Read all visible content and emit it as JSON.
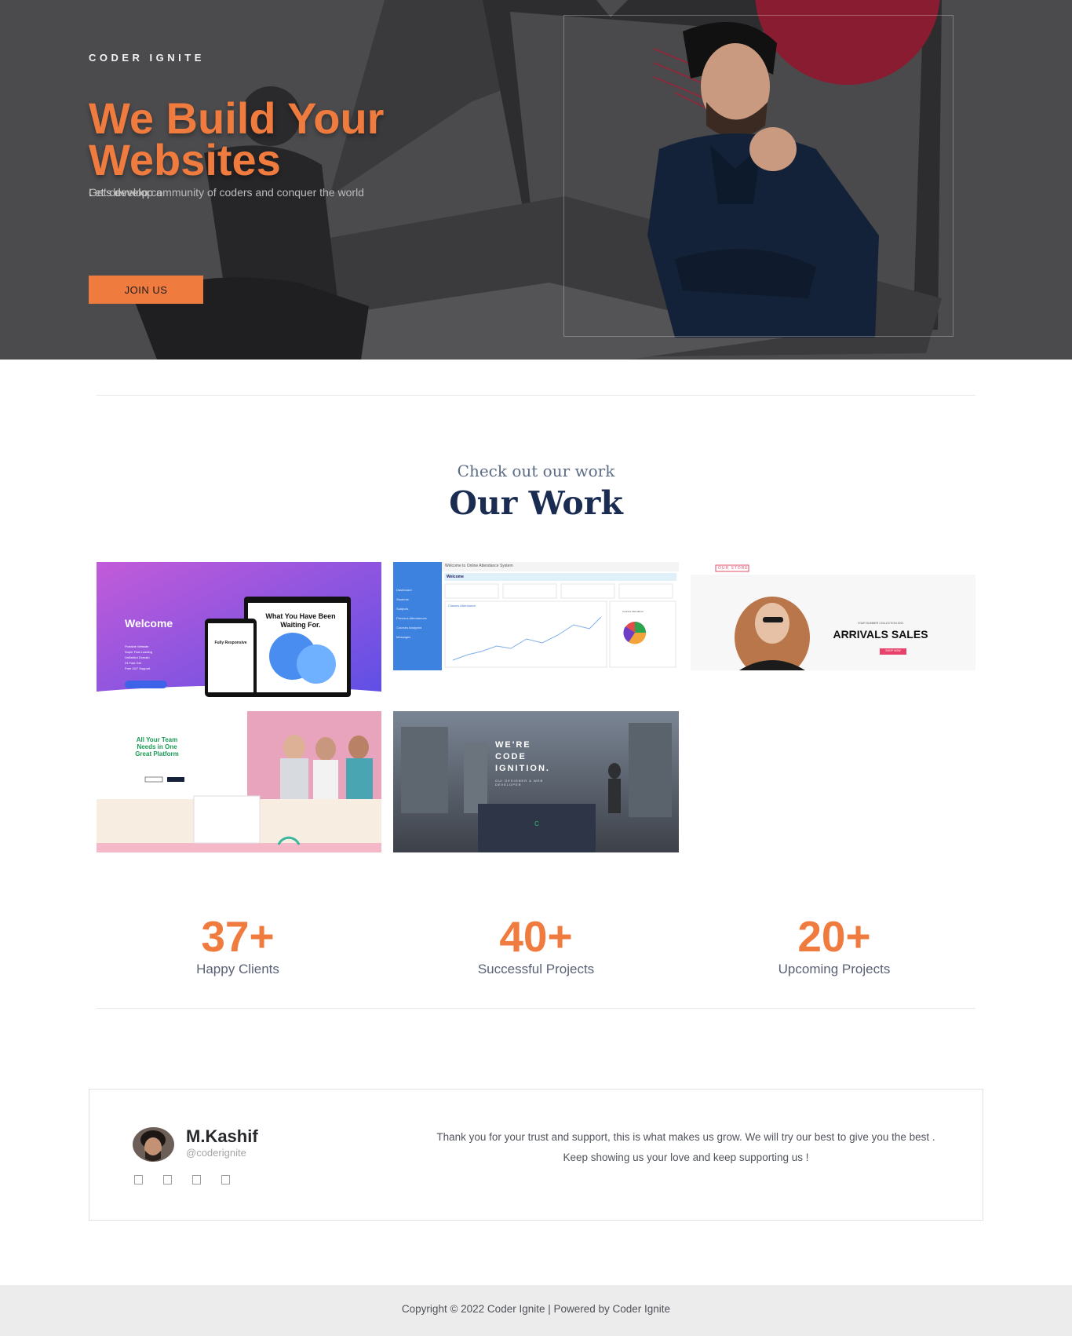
{
  "hero": {
    "brand": "CODER IGNITE",
    "headline": "We Build Your Websites",
    "typed_text": "Let's develop a",
    "tagline": "Get develop community of coders and conquer the world",
    "cta": "JOIN US"
  },
  "work": {
    "subtitle": "Check out our work",
    "title": "Our Work",
    "projects": [
      {
        "welcome": "Welcome",
        "headline": "What You Have Been Waiting For.",
        "device_title": "Fully Responsive",
        "features": [
          "Portable Website",
          "Super Fast Loading",
          "Unlimited Domain",
          "24 Fast Get",
          "Free 24/7 Support"
        ]
      },
      {
        "header": "Welcome to Online Attendance System",
        "banner": "Welcome",
        "sidebar_items": [
          "Dashboard",
          "Students",
          "Subjects",
          "Previous Attendances",
          "Courses Assigned",
          "Messages"
        ],
        "chart_title": "Classes Attendance",
        "legend_title": "Courses Attendance"
      },
      {
        "logo": "OUR STORE",
        "kicker": "YOUR SUMMER COLLECTION 2021",
        "headline": "ARRIVALS SALES",
        "button": "SHOP NOW"
      },
      {
        "headline": "All Your Team Needs in One Great Platform"
      },
      {
        "headline": "WE'RE CODE IGNITION.",
        "sub": "GUI DESIGNER & WEB DEVELOPER"
      }
    ]
  },
  "stats": [
    {
      "value": "37+",
      "label": "Happy Clients"
    },
    {
      "value": "40+",
      "label": "Successful Projects"
    },
    {
      "value": "20+",
      "label": "Upcoming Projects"
    }
  ],
  "testimonial": {
    "name": "M.Kashif",
    "handle": "@coderignite",
    "text": "Thank you for your trust and support, this is what makes us grow. We will try our best to give you the best . Keep showing us your love and keep supporting us !",
    "socials": [
      "facebook-icon",
      "twitter-icon",
      "instagram-icon",
      "linkedin-icon"
    ]
  },
  "footer": {
    "copyright": "Copyright © 2022 Coder Ignite | Powered by Coder Ignite"
  },
  "colors": {
    "accent": "#f07b3f",
    "hero_bg": "#4b4a4c",
    "title_navy": "#1b2c52"
  }
}
